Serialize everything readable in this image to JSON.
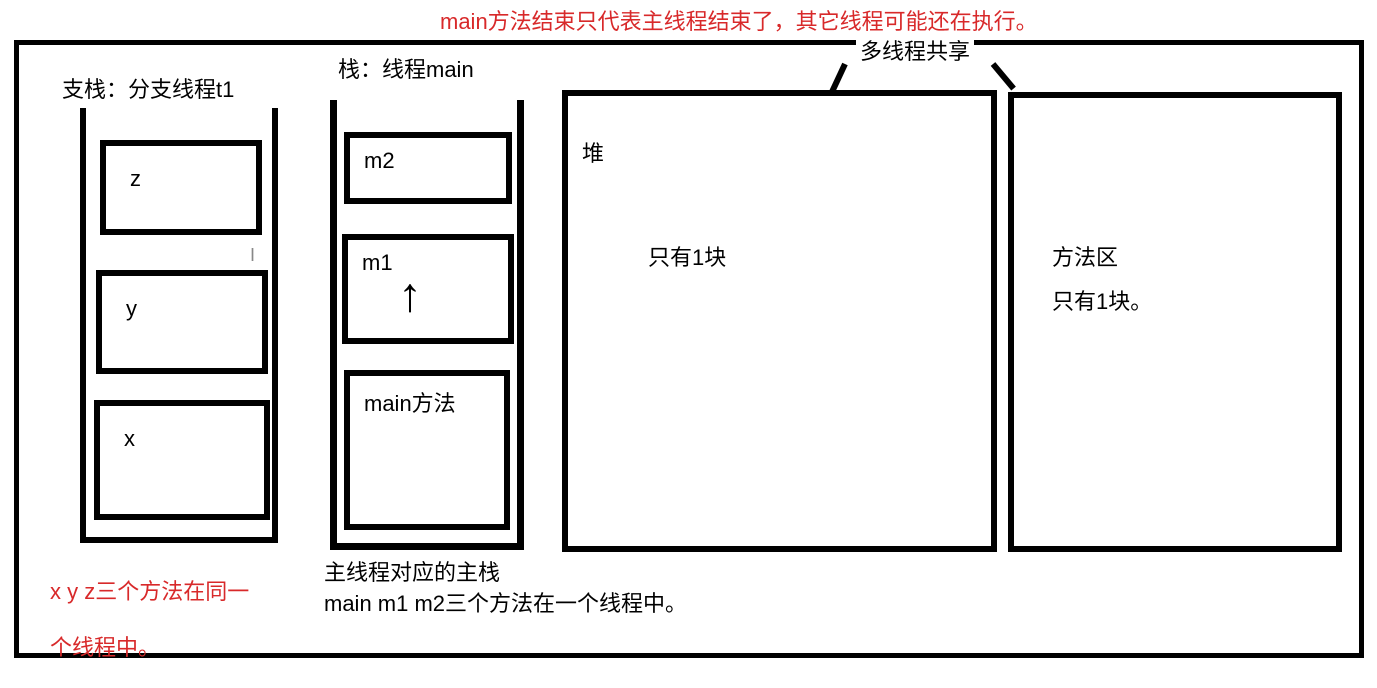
{
  "annotation_top": "main方法结束只代表主线程结束了，其它线程可能还在执行。",
  "stack1": {
    "title": "支栈：分支线程t1",
    "frames": {
      "z": "z",
      "y": "y",
      "x": "x"
    },
    "note_line1": "x y z三个方法在同一",
    "note_line2": "个线程中。"
  },
  "stack2": {
    "title": "栈：线程main",
    "frames": {
      "m2": "m2",
      "m1": "m1",
      "main": "main方法"
    },
    "note_line1": "主线程对应的主栈",
    "note_line2": "main m1 m2三个方法在一个线程中。"
  },
  "heap": {
    "label": "堆",
    "text": "只有1块"
  },
  "method_area": {
    "label": "方法区",
    "text": "只有1块。"
  },
  "shared_label": "多线程共享"
}
